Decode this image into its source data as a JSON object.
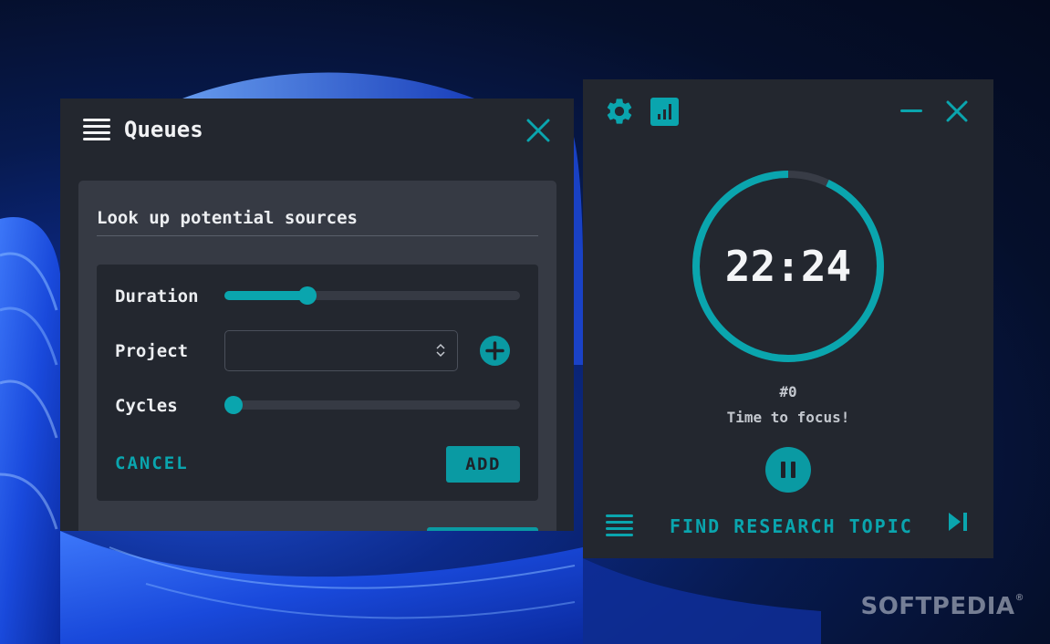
{
  "colors": {
    "accent": "#0aa5ae",
    "window_bg": "#23272f",
    "card_bg": "#363a44",
    "text": "#f2f3f5"
  },
  "watermark": {
    "text": "SOFTPEDIA",
    "mark": "®"
  },
  "queues": {
    "title": "Queues",
    "menu_icon": "queue-list-icon",
    "close_icon": "close-icon",
    "task": {
      "name": "Look up potential sources",
      "duration_label": "Duration",
      "duration_fraction": 0.28,
      "project_label": "Project",
      "project_value": "",
      "add_project_icon": "plus-icon",
      "cycles_label": "Cycles",
      "cycles_fraction": 0.0,
      "cancel_label": "CANCEL",
      "add_label": "ADD"
    }
  },
  "timer": {
    "settings_icon": "gear-icon",
    "stats_icon": "bar-chart-icon",
    "minimize_icon": "minimize-icon",
    "close_icon": "close-icon",
    "time": "22:24",
    "progress_fraction": 0.93,
    "cycle": "#0",
    "status": "Time to focus!",
    "pause_icon": "pause-icon",
    "queue_icon": "queue-list-icon",
    "task_title": "FIND RESEARCH TOPIC",
    "skip_icon": "skip-next-icon"
  }
}
